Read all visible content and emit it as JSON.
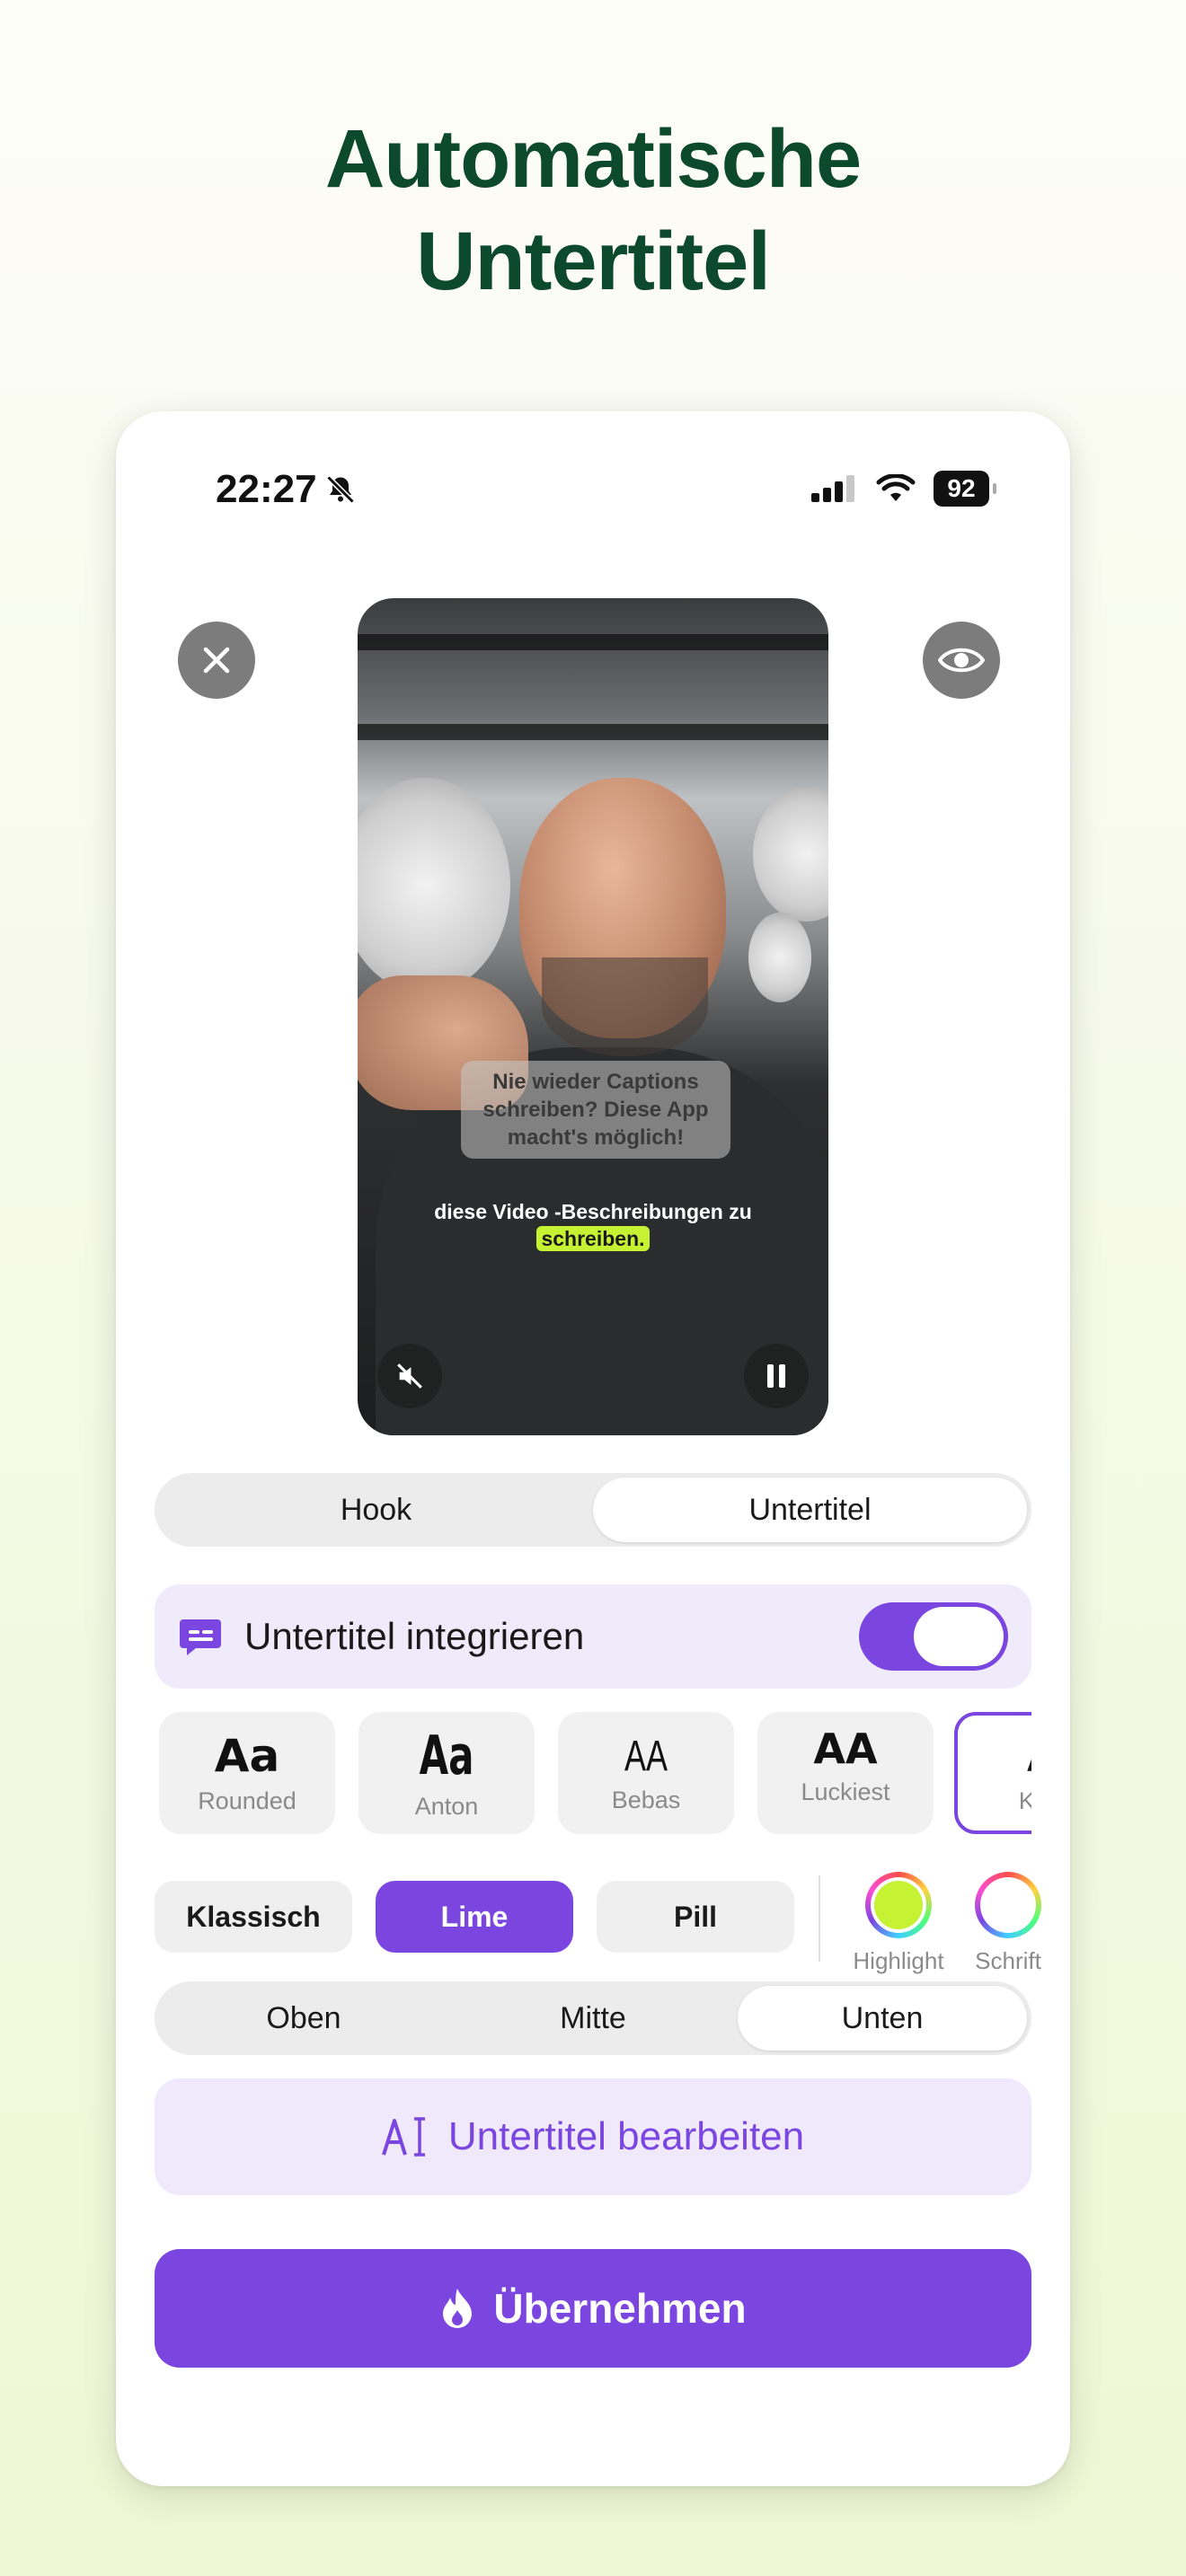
{
  "headline": {
    "line1": "Automatische",
    "line2": "Untertitel"
  },
  "status_bar": {
    "time": "22:27",
    "battery": "92"
  },
  "video": {
    "hook_caption": "Nie wieder Captions schreiben? Diese App macht's möglich!",
    "subtitle_text": "diese Video -Beschreibungen zu",
    "subtitle_highlight": "schreiben."
  },
  "mode_tabs": [
    {
      "label": "Hook",
      "active": false
    },
    {
      "label": "Untertitel",
      "active": true
    }
  ],
  "integrate": {
    "label": "Untertitel integrieren",
    "enabled": true
  },
  "fonts": [
    {
      "sample": "Aa",
      "name": "Rounded"
    },
    {
      "sample": "Aa",
      "name": "Anton"
    },
    {
      "sample": "AA",
      "name": "Bebas"
    },
    {
      "sample": "AA",
      "name": "Luckiest"
    },
    {
      "sample": "A",
      "name": "Klas"
    }
  ],
  "styles": [
    {
      "label": "Klassisch",
      "active": false
    },
    {
      "label": "Lime",
      "active": true
    },
    {
      "label": "Pill",
      "active": false
    }
  ],
  "swatches": [
    {
      "label": "Highlight",
      "color": "#c5f232"
    },
    {
      "label": "Schrift",
      "color": "#ffffff"
    }
  ],
  "position_tabs": [
    {
      "label": "Oben",
      "active": false
    },
    {
      "label": "Mitte",
      "active": false
    },
    {
      "label": "Unten",
      "active": true
    }
  ],
  "edit_button": {
    "icon": "text-cursor-icon",
    "label": "Untertitel bearbeiten"
  },
  "apply_button": {
    "icon": "flame-icon",
    "label": "Übernehmen"
  },
  "colors": {
    "accent": "#7b46e0",
    "headline": "#0d4a2b",
    "lime": "#c5f232"
  }
}
